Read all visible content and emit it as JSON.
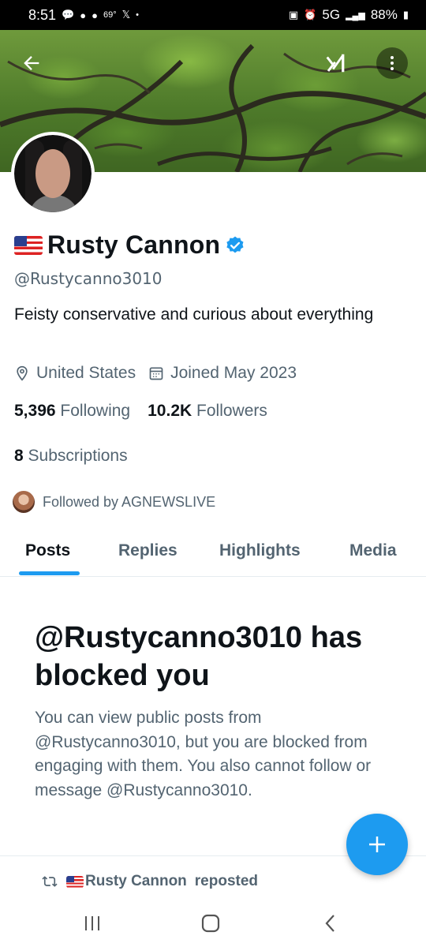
{
  "status_bar": {
    "time": "8:51",
    "temperature": "69°",
    "network": "5G",
    "battery": "88%"
  },
  "profile": {
    "display_name": "Rusty Cannon",
    "handle": "@Rustycanno3010",
    "bio": "Feisty conservative and curious about everything",
    "location": "United States",
    "joined": "Joined May 2023",
    "following_count": "5,396",
    "following_label": "Following",
    "followers_count": "10.2K",
    "followers_label": "Followers",
    "subscriptions_count": "8",
    "subscriptions_label": "Subscriptions",
    "followed_by": "Followed by AGNEWSLIVE"
  },
  "tabs": [
    {
      "label": "Posts",
      "active": true
    },
    {
      "label": "Replies",
      "active": false
    },
    {
      "label": "Highlights",
      "active": false
    },
    {
      "label": "Media",
      "active": false
    }
  ],
  "blocked": {
    "title": "@Rustycanno3010 has blocked you",
    "body": "You can view public posts from @Rustycanno3010, but you are blocked from engaging with them. You also cannot follow or message @Rustycanno3010."
  },
  "repost": {
    "name": "Rusty Cannon",
    "suffix": "reposted"
  },
  "colors": {
    "accent": "#1d9bf0",
    "text_primary": "#0f1419",
    "text_secondary": "#536471"
  },
  "icons": {
    "back": "arrow-left-icon",
    "grok": "grok-icon",
    "more": "more-vertical-icon",
    "location": "location-pin-icon",
    "calendar": "calendar-icon",
    "verified": "verified-badge-icon",
    "compose": "plus-icon",
    "repost": "repost-icon"
  }
}
